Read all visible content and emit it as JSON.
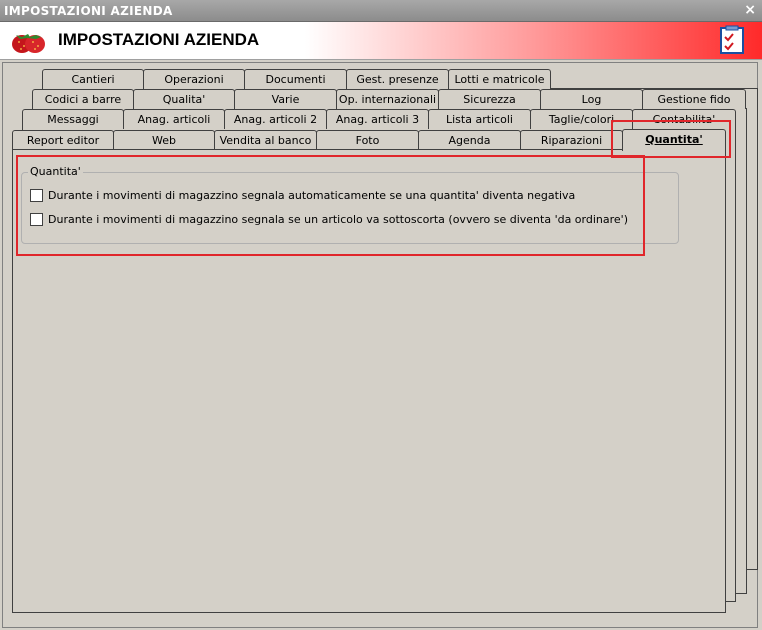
{
  "window": {
    "title": "IMPOSTAZIONI AZIENDA",
    "close_label": "×"
  },
  "header": {
    "title": "IMPOSTAZIONI AZIENDA"
  },
  "tabs": {
    "row1": [
      "Cantieri",
      "Operazioni",
      "Documenti",
      "Gest. presenze",
      "Lotti e matricole"
    ],
    "row2": [
      "Codici a barre",
      "Qualita'",
      "Varie",
      "Op. internazionali",
      "Sicurezza",
      "Log",
      "Gestione fido"
    ],
    "row3": [
      "Messaggi",
      "Anag. articoli",
      "Anag. articoli 2",
      "Anag. articoli 3",
      "Lista articoli",
      "Taglie/colori",
      "Contabilita'"
    ],
    "row4": [
      "Report editor",
      "Web",
      "Vendita al banco",
      "Foto",
      "Agenda",
      "Riparazioni",
      "Quantita'"
    ]
  },
  "group": {
    "title": "Quantita'",
    "options": [
      {
        "label": "Durante i movimenti di magazzino segnala automaticamente se una quantita' diventa negativa",
        "checked": false
      },
      {
        "label": "Durante i movimenti di magazzino segnala se un articolo va sottoscorta (ovvero se diventa 'da ordinare')",
        "checked": false
      }
    ]
  },
  "colors": {
    "highlight": "#e0262b",
    "header_gradient_end": "#ff2a2a",
    "titlebar": "#999999"
  }
}
